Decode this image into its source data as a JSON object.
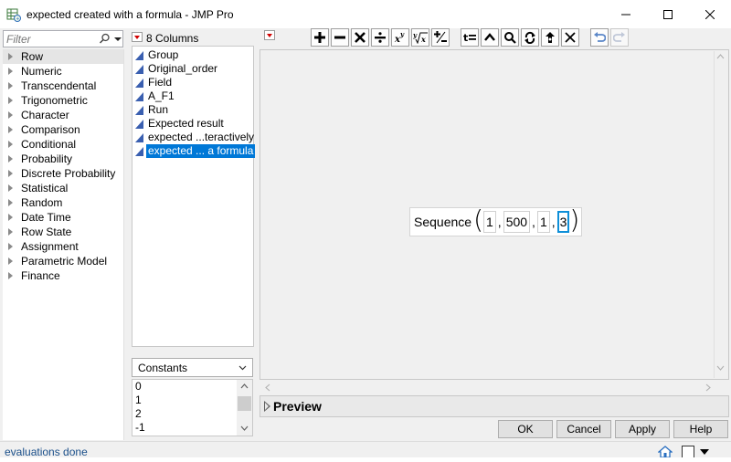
{
  "window": {
    "title": "expected created with a formula - JMP Pro"
  },
  "functions": {
    "filter_placeholder": "Filter",
    "categories": [
      "Row",
      "Numeric",
      "Transcendental",
      "Trigonometric",
      "Character",
      "Comparison",
      "Conditional",
      "Probability",
      "Discrete Probability",
      "Statistical",
      "Random",
      "Date Time",
      "Row State",
      "Assignment",
      "Parametric Model",
      "Finance"
    ],
    "selected": "Row"
  },
  "columns": {
    "header": "8 Columns",
    "items": [
      "Group",
      "Original_order",
      "Field",
      "A_F1",
      "Run",
      "Expected result",
      "expected ...teractively",
      "expected ... a formula"
    ],
    "selected_index": 7
  },
  "constants": {
    "selected": "Constants",
    "items": [
      "0",
      "1",
      "2",
      "-1"
    ]
  },
  "toolbar": {
    "buttons": [
      "add-icon",
      "subtract-icon",
      "multiply-icon",
      "divide-icon",
      "power-icon",
      "root-icon",
      "plus-minus-icon",
      "assign-icon",
      "peel-icon",
      "local-icon",
      "swap-icon",
      "recode-icon",
      "delete-icon",
      "undo-icon",
      "redo-icon"
    ]
  },
  "formula": {
    "function": "Sequence",
    "args": [
      "1",
      "500",
      "1",
      "3"
    ],
    "separator": ",",
    "focused_arg_index": 3
  },
  "preview": {
    "label": "Preview"
  },
  "dialog": {
    "ok": "OK",
    "cancel": "Cancel",
    "apply": "Apply",
    "help": "Help"
  },
  "status": {
    "text": "evaluations done"
  }
}
